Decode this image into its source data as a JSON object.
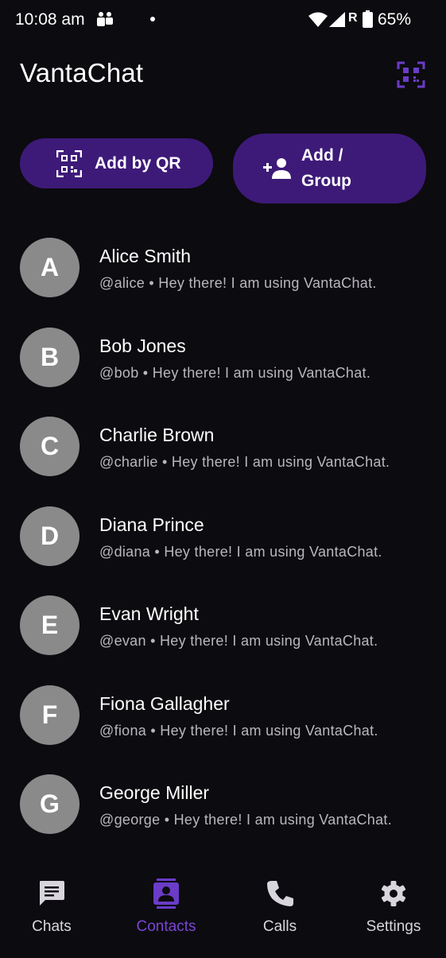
{
  "status_bar": {
    "time": "10:08 am",
    "carrier_flag": "R",
    "battery": "65%",
    "icons": [
      "teams-icon",
      "notification-dot",
      "wifi-icon",
      "signal-icon",
      "battery-icon"
    ]
  },
  "app_bar": {
    "title": "VantaChat",
    "qr_icon": "qr-code-icon"
  },
  "actions": {
    "add_by_qr": "Add by QR",
    "add_group": "Add /\nGroup"
  },
  "contacts": [
    {
      "initial": "A",
      "name": "Alice Smith",
      "subtitle": "@alice • Hey there! I am using VantaChat."
    },
    {
      "initial": "B",
      "name": "Bob Jones",
      "subtitle": "@bob • Hey there! I am using VantaChat."
    },
    {
      "initial": "C",
      "name": "Charlie Brown",
      "subtitle": "@charlie • Hey there! I am using VantaChat."
    },
    {
      "initial": "D",
      "name": "Diana Prince",
      "subtitle": "@diana • Hey there! I am using VantaChat."
    },
    {
      "initial": "E",
      "name": "Evan Wright",
      "subtitle": "@evan • Hey there! I am using VantaChat."
    },
    {
      "initial": "F",
      "name": "Fiona Gallagher",
      "subtitle": "@fiona • Hey there! I am using VantaChat."
    },
    {
      "initial": "G",
      "name": "George Miller",
      "subtitle": "@george • Hey there! I am using VantaChat."
    }
  ],
  "bottom_nav": {
    "items": [
      {
        "label": "Chats",
        "icon": "chat-icon",
        "active": false
      },
      {
        "label": "Contacts",
        "icon": "contacts-icon",
        "active": true
      },
      {
        "label": "Calls",
        "icon": "phone-icon",
        "active": false
      },
      {
        "label": "Settings",
        "icon": "gear-icon",
        "active": false
      }
    ]
  },
  "colors": {
    "background": "#0c0b0f",
    "accent": "#7a45d6",
    "button_fill": "#3d1a78",
    "avatar": "#8a8a8a"
  }
}
